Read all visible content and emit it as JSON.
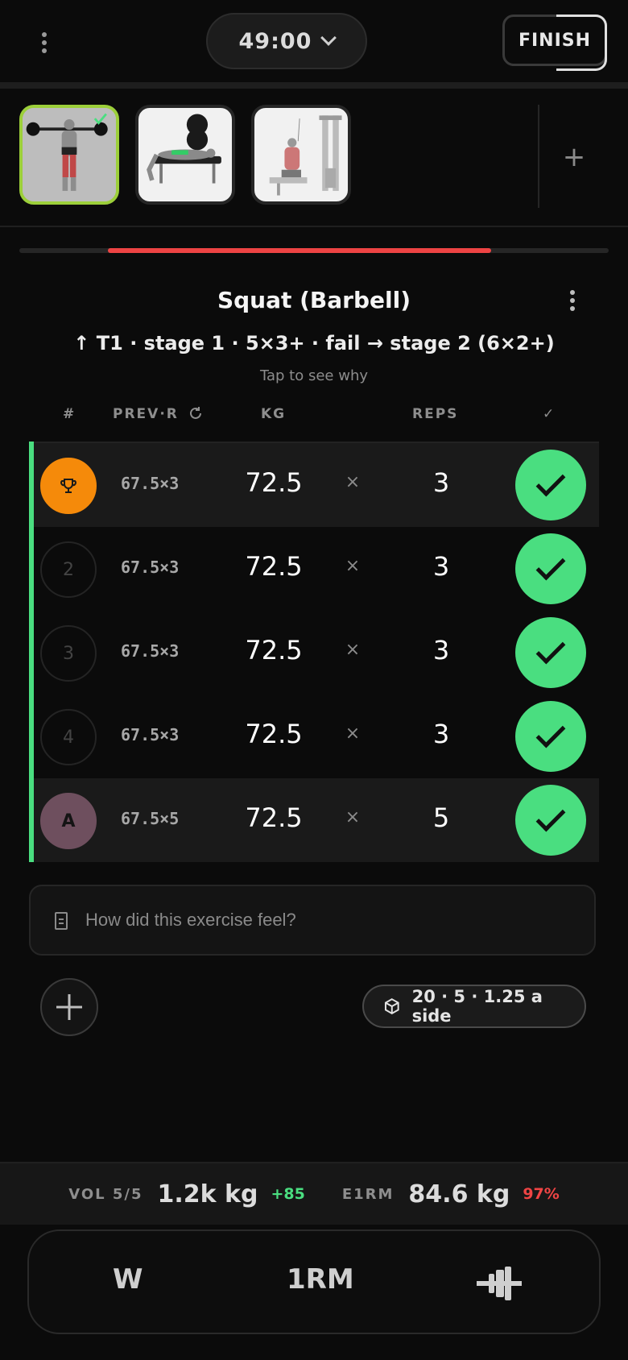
{
  "header": {
    "timer": "49:00",
    "finish_label": "FINISH"
  },
  "thumbnails": [
    {
      "name": "Squat (Barbell)",
      "active": true
    },
    {
      "name": "Bench Press",
      "active": false
    },
    {
      "name": "Lat Pulldown / Cable Row",
      "active": false
    }
  ],
  "progress": {
    "fraction": 0.65
  },
  "exercise": {
    "title": "Squat (Barbell)",
    "stage": "↑ T1 · stage 1 · 5×3+ · fail → stage 2 (6×2+)",
    "hint": "Tap to see why"
  },
  "table": {
    "headers": {
      "num": "#",
      "prev": "PREV·R",
      "kg": "KG",
      "reps": "REPS",
      "check": "✓"
    },
    "rows": [
      {
        "set": "",
        "icon": "trophy-icon",
        "prev": "67.5×3",
        "kg": "72.5",
        "times": "×",
        "reps": "3",
        "done": true
      },
      {
        "set": "2",
        "prev": "67.5×3",
        "kg": "72.5",
        "times": "×",
        "reps": "3",
        "done": true
      },
      {
        "set": "3",
        "prev": "67.5×3",
        "kg": "72.5",
        "times": "×",
        "reps": "3",
        "done": true
      },
      {
        "set": "4",
        "prev": "67.5×3",
        "kg": "72.5",
        "times": "×",
        "reps": "3",
        "done": true
      },
      {
        "set": "A",
        "prev": "67.5×5",
        "kg": "72.5",
        "times": "×",
        "reps": "5",
        "done": true
      }
    ]
  },
  "notes": {
    "placeholder": "How did this exercise feel?"
  },
  "plates": {
    "text": "20 · 5 · 1.25 a side"
  },
  "stats": {
    "vol_label": "VOL 5/5",
    "vol_value": "1.2k kg",
    "vol_delta": "+85",
    "e1rm_label": "E1RM",
    "e1rm_value": "84.6 kg",
    "e1rm_pct": "97%"
  },
  "bottombar": {
    "warmup_label": "W",
    "onerm_label": "1RM",
    "plate_icon": "dumbbell-icon"
  },
  "colors": {
    "accent_green": "#4ade80",
    "progress_red": "#ee4444",
    "trophy_orange": "#f58a0a",
    "active_thumb_border": "#9ccf3a"
  }
}
